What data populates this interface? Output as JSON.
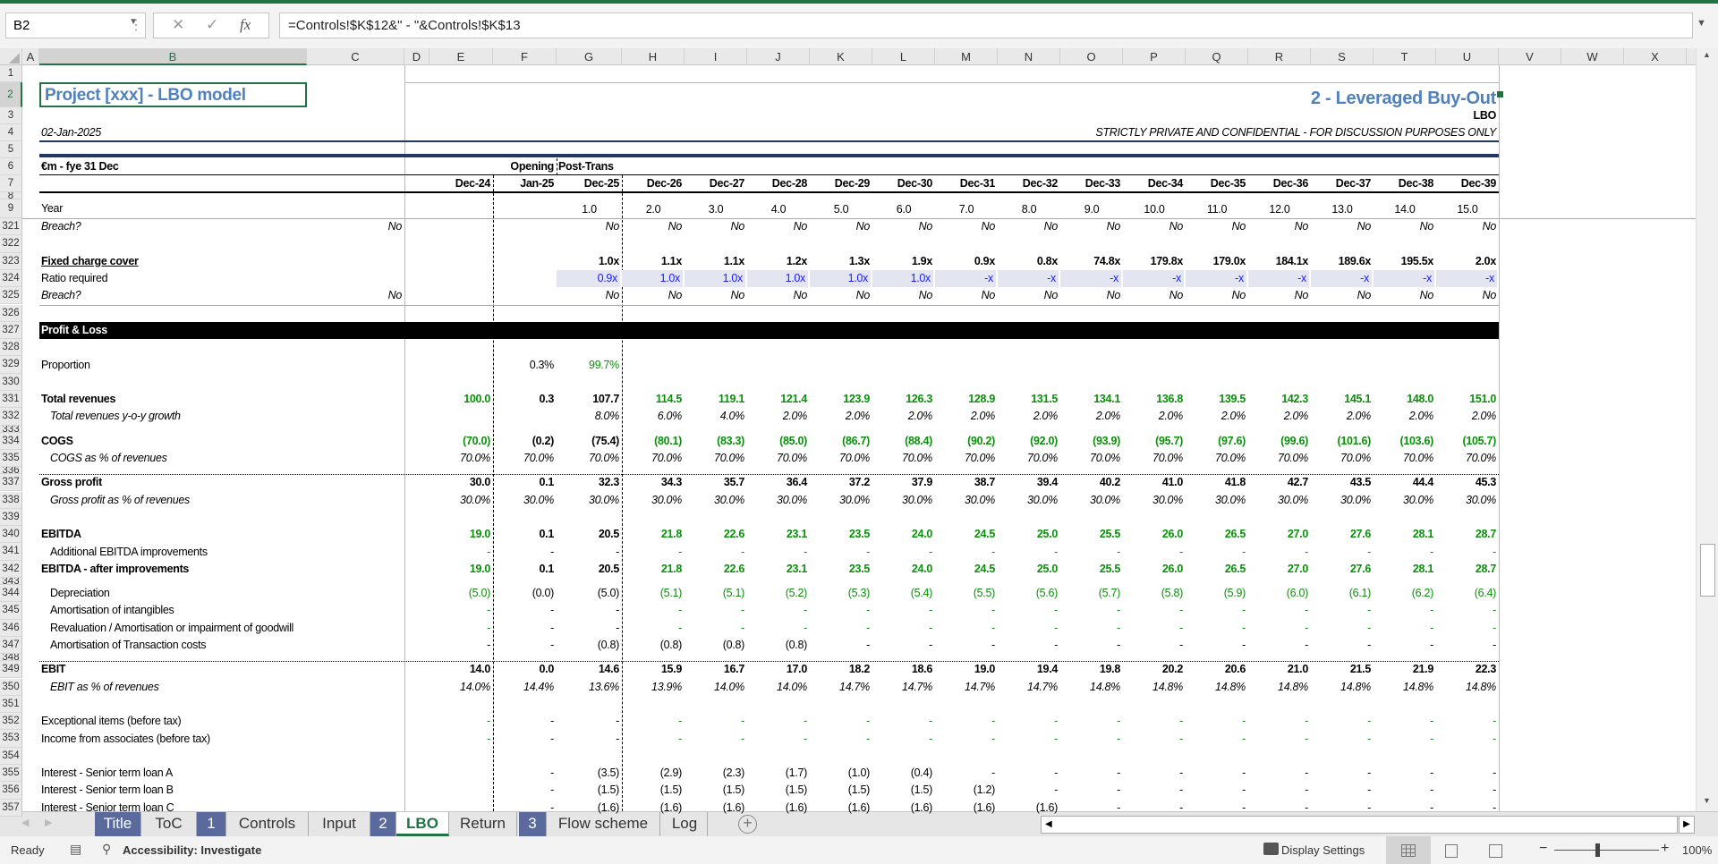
{
  "formula_bar": {
    "name_box": "B2",
    "cancel_icon": "✕",
    "enter_icon": "✓",
    "fx_icon": "fx",
    "formula": "=Controls!$K$12&\" - \"&Controls!$K$13"
  },
  "columns": [
    "A",
    "B",
    "C",
    "D",
    "E",
    "F",
    "G",
    "H",
    "I",
    "J",
    "K",
    "L",
    "M",
    "N",
    "O",
    "P",
    "Q",
    "R",
    "S",
    "T",
    "U",
    "V",
    "W",
    "X"
  ],
  "selected_column": "B",
  "header_rows": [
    "1",
    "2",
    "3",
    "4",
    "5",
    "6",
    "7",
    "8",
    "9"
  ],
  "header": {
    "title": "Project [xxx]  - LBO model",
    "section": "2 - Leveraged Buy-Out",
    "sheet_code": "LBO",
    "date": "02-Jan-2025",
    "confidential": "STRICTLY PRIVATE AND CONFIDENTIAL - FOR DISCUSSION PURPOSES ONLY",
    "units": "€m - fye 31 Dec",
    "opening": "Opening",
    "post_trans": "Post-Trans",
    "periods": [
      "Dec-24",
      "Jan-25",
      "Dec-25",
      "Dec-26",
      "Dec-27",
      "Dec-28",
      "Dec-29",
      "Dec-30",
      "Dec-31",
      "Dec-32",
      "Dec-33",
      "Dec-34",
      "Dec-35",
      "Dec-36",
      "Dec-37",
      "Dec-38",
      "Dec-39"
    ],
    "year_label": "Year",
    "years": [
      "",
      "",
      "1.0",
      "2.0",
      "3.0",
      "4.0",
      "5.0",
      "6.0",
      "7.0",
      "8.0",
      "9.0",
      "10.0",
      "11.0",
      "12.0",
      "13.0",
      "14.0",
      "15.0"
    ]
  },
  "colors": {
    "green": "#0b900b",
    "blue": "#1a1aff",
    "title_blue": "#4f81bd",
    "navy": "#1f3864",
    "tab_number": "#5b6a9c",
    "excel_green": "#217346"
  },
  "rows": [
    {
      "num": "321",
      "label": "Breach?",
      "italic": true,
      "c": "No",
      "values": [
        "",
        "",
        "No",
        "No",
        "No",
        "No",
        "No",
        "No",
        "No",
        "No",
        "No",
        "No",
        "No",
        "No",
        "No",
        "No",
        "No"
      ]
    },
    {
      "num": "322",
      "label": ""
    },
    {
      "num": "323",
      "label": "Fixed charge cover",
      "bold": true,
      "underline": true,
      "values": [
        "",
        "",
        "1.0x",
        "1.1x",
        "1.1x",
        "1.2x",
        "1.3x",
        "1.9x",
        "0.9x",
        "0.8x",
        "74.8x",
        "179.8x",
        "179.0x",
        "184.1x",
        "189.6x",
        "195.5x",
        "2.0x"
      ]
    },
    {
      "num": "324",
      "label": "Ratio required",
      "input": true,
      "values": [
        "",
        "",
        "0.9x",
        "1.0x",
        "1.0x",
        "1.0x",
        "1.0x",
        "1.0x",
        "-x",
        "-x",
        "-x",
        "-x",
        "-x",
        "-x",
        "-x",
        "-x",
        "-x"
      ]
    },
    {
      "num": "325",
      "label": "Breach?",
      "italic": true,
      "c": "No",
      "values": [
        "",
        "",
        "No",
        "No",
        "No",
        "No",
        "No",
        "No",
        "No",
        "No",
        "No",
        "No",
        "No",
        "No",
        "No",
        "No",
        "No"
      ]
    },
    {
      "num": "326",
      "label": ""
    },
    {
      "num": "327",
      "label": "Profit & Loss",
      "band": true
    },
    {
      "num": "328",
      "label": ""
    },
    {
      "num": "329",
      "label": "Proportion",
      "green_cols": [
        "G"
      ],
      "values": [
        "",
        "0.3%",
        "99.7%",
        "",
        "",
        "",
        "",
        "",
        "",
        "",
        "",
        "",
        "",
        "",
        "",
        "",
        ""
      ]
    },
    {
      "num": "330",
      "label": ""
    },
    {
      "num": "331",
      "label": "Total revenues",
      "bold": true,
      "tone": "green",
      "values": [
        "100.0",
        "0.3",
        "107.7",
        "114.5",
        "119.1",
        "121.4",
        "123.9",
        "126.3",
        "128.9",
        "131.5",
        "134.1",
        "136.8",
        "139.5",
        "142.3",
        "145.1",
        "148.0",
        "151.0"
      ]
    },
    {
      "num": "332",
      "label": "Total revenues y-o-y growth",
      "italic": true,
      "indent": true,
      "values": [
        "",
        "",
        "8.0%",
        "6.0%",
        "4.0%",
        "2.0%",
        "2.0%",
        "2.0%",
        "2.0%",
        "2.0%",
        "2.0%",
        "2.0%",
        "2.0%",
        "2.0%",
        "2.0%",
        "2.0%",
        "2.0%"
      ]
    },
    {
      "num": "333",
      "short": true
    },
    {
      "num": "334",
      "label": "COGS",
      "bold": true,
      "tone": "green",
      "values": [
        "(70.0)",
        "(0.2)",
        "(75.4)",
        "(80.1)",
        "(83.3)",
        "(85.0)",
        "(86.7)",
        "(88.4)",
        "(90.2)",
        "(92.0)",
        "(93.9)",
        "(95.7)",
        "(97.6)",
        "(99.6)",
        "(101.6)",
        "(103.6)",
        "(105.7)"
      ]
    },
    {
      "num": "335",
      "label": "COGS as % of revenues",
      "italic": true,
      "indent": true,
      "values": [
        "70.0%",
        "70.0%",
        "70.0%",
        "70.0%",
        "70.0%",
        "70.0%",
        "70.0%",
        "70.0%",
        "70.0%",
        "70.0%",
        "70.0%",
        "70.0%",
        "70.0%",
        "70.0%",
        "70.0%",
        "70.0%",
        "70.0%"
      ]
    },
    {
      "num": "336",
      "short": true
    },
    {
      "num": "337",
      "label": "Gross profit",
      "bold": true,
      "dotted_top": true,
      "values": [
        "30.0",
        "0.1",
        "32.3",
        "34.3",
        "35.7",
        "36.4",
        "37.2",
        "37.9",
        "38.7",
        "39.4",
        "40.2",
        "41.0",
        "41.8",
        "42.7",
        "43.5",
        "44.4",
        "45.3"
      ]
    },
    {
      "num": "338",
      "label": "Gross profit as % of revenues",
      "italic": true,
      "indent": true,
      "values": [
        "30.0%",
        "30.0%",
        "30.0%",
        "30.0%",
        "30.0%",
        "30.0%",
        "30.0%",
        "30.0%",
        "30.0%",
        "30.0%",
        "30.0%",
        "30.0%",
        "30.0%",
        "30.0%",
        "30.0%",
        "30.0%",
        "30.0%"
      ]
    },
    {
      "num": "339",
      "label": ""
    },
    {
      "num": "340",
      "label": "EBITDA",
      "bold": true,
      "tone": "green",
      "values": [
        "19.0",
        "0.1",
        "20.5",
        "21.8",
        "22.6",
        "23.1",
        "23.5",
        "24.0",
        "24.5",
        "25.0",
        "25.5",
        "26.0",
        "26.5",
        "27.0",
        "27.6",
        "28.1",
        "28.7"
      ]
    },
    {
      "num": "341",
      "label": "Additional EBITDA improvements",
      "indent": true,
      "tone": "green",
      "values": [
        "-",
        "-",
        "-",
        "-",
        "-",
        "-",
        "-",
        "-",
        "-",
        "-",
        "-",
        "-",
        "-",
        "-",
        "-",
        "-",
        "-"
      ]
    },
    {
      "num": "342",
      "label": "EBITDA - after improvements",
      "bold": true,
      "tone": "green",
      "values": [
        "19.0",
        "0.1",
        "20.5",
        "21.8",
        "22.6",
        "23.1",
        "23.5",
        "24.0",
        "24.5",
        "25.0",
        "25.5",
        "26.0",
        "26.5",
        "27.0",
        "27.6",
        "28.1",
        "28.7"
      ]
    },
    {
      "num": "343",
      "short": true
    },
    {
      "num": "344",
      "label": "Depreciation",
      "indent": true,
      "tone": "green",
      "values": [
        "(5.0)",
        "(0.0)",
        "(5.0)",
        "(5.1)",
        "(5.1)",
        "(5.2)",
        "(5.3)",
        "(5.4)",
        "(5.5)",
        "(5.6)",
        "(5.7)",
        "(5.8)",
        "(5.9)",
        "(6.0)",
        "(6.1)",
        "(6.2)",
        "(6.4)"
      ]
    },
    {
      "num": "345",
      "label": "Amortisation of intangibles",
      "indent": true,
      "tone": "green",
      "values": [
        "-",
        "-",
        "-",
        "-",
        "-",
        "-",
        "-",
        "-",
        "-",
        "-",
        "-",
        "-",
        "-",
        "-",
        "-",
        "-",
        "-"
      ]
    },
    {
      "num": "346",
      "label": "Revaluation / Amortisation or impairment of goodwill",
      "indent": true,
      "tone": "green",
      "values": [
        "-",
        "-",
        "-",
        "-",
        "-",
        "-",
        "-",
        "-",
        "-",
        "-",
        "-",
        "-",
        "-",
        "-",
        "-",
        "-",
        "-"
      ]
    },
    {
      "num": "347",
      "label": "Amortisation of Transaction costs",
      "indent": true,
      "values": [
        "-",
        "-",
        "(0.8)",
        "(0.8)",
        "(0.8)",
        "(0.8)",
        "-",
        "-",
        "-",
        "-",
        "-",
        "-",
        "-",
        "-",
        "-",
        "-",
        "-"
      ]
    },
    {
      "num": "348",
      "short": true
    },
    {
      "num": "349",
      "label": "EBIT",
      "bold": true,
      "dotted_top": true,
      "values": [
        "14.0",
        "0.0",
        "14.6",
        "15.9",
        "16.7",
        "17.0",
        "18.2",
        "18.6",
        "19.0",
        "19.4",
        "19.8",
        "20.2",
        "20.6",
        "21.0",
        "21.5",
        "21.9",
        "22.3"
      ]
    },
    {
      "num": "350",
      "label": "EBIT as % of revenues",
      "italic": true,
      "indent": true,
      "values": [
        "14.0%",
        "14.4%",
        "13.6%",
        "13.9%",
        "14.0%",
        "14.0%",
        "14.7%",
        "14.7%",
        "14.7%",
        "14.7%",
        "14.8%",
        "14.8%",
        "14.8%",
        "14.8%",
        "14.8%",
        "14.8%",
        "14.8%"
      ]
    },
    {
      "num": "351",
      "label": ""
    },
    {
      "num": "352",
      "label": "Exceptional items (before tax)",
      "tone": "green",
      "values": [
        "-",
        "-",
        "-",
        "-",
        "-",
        "-",
        "-",
        "-",
        "-",
        "-",
        "-",
        "-",
        "-",
        "-",
        "-",
        "-",
        "-"
      ]
    },
    {
      "num": "353",
      "label": "Income from associates (before tax)",
      "tone": "green",
      "values": [
        "-",
        "-",
        "-",
        "-",
        "-",
        "-",
        "-",
        "-",
        "-",
        "-",
        "-",
        "-",
        "-",
        "-",
        "-",
        "-",
        "-"
      ]
    },
    {
      "num": "354",
      "label": ""
    },
    {
      "num": "355",
      "label": "Interest - Senior term loan A",
      "values": [
        "",
        "-",
        "(3.5)",
        "(2.9)",
        "(2.3)",
        "(1.7)",
        "(1.0)",
        "(0.4)",
        "-",
        "-",
        "-",
        "-",
        "-",
        "-",
        "-",
        "-",
        "-"
      ]
    },
    {
      "num": "356",
      "label": "Interest - Senior term loan B",
      "values": [
        "",
        "-",
        "(1.5)",
        "(1.5)",
        "(1.5)",
        "(1.5)",
        "(1.5)",
        "(1.5)",
        "(1.2)",
        "-",
        "-",
        "-",
        "-",
        "-",
        "-",
        "-",
        "-"
      ]
    },
    {
      "num": "357",
      "label": "Interest - Senior term loan C",
      "values": [
        "",
        "-",
        "(1.6)",
        "(1.6)",
        "(1.6)",
        "(1.6)",
        "(1.6)",
        "(1.6)",
        "(1.6)",
        "(1.6)",
        "-",
        "-",
        "-",
        "-",
        "-",
        "-",
        "-"
      ]
    }
  ],
  "tabs": [
    {
      "label": "Title",
      "number": true
    },
    {
      "label": "ToC"
    },
    {
      "label": "1",
      "number": true
    },
    {
      "label": "Controls"
    },
    {
      "label": "Input"
    },
    {
      "label": "2",
      "number": true
    },
    {
      "label": "LBO",
      "active": true
    },
    {
      "label": "Return"
    },
    {
      "label": "3",
      "number": true
    },
    {
      "label": "Flow scheme"
    },
    {
      "label": "Log"
    }
  ],
  "tab_nav": {
    "prev_icon": "◀",
    "next_icon": "▶",
    "add_icon": "+"
  },
  "status": {
    "ready": "Ready",
    "accessibility": "Accessibility: Investigate",
    "display_settings": "Display Settings",
    "zoom": "100%",
    "zoom_level_percent": 100
  }
}
